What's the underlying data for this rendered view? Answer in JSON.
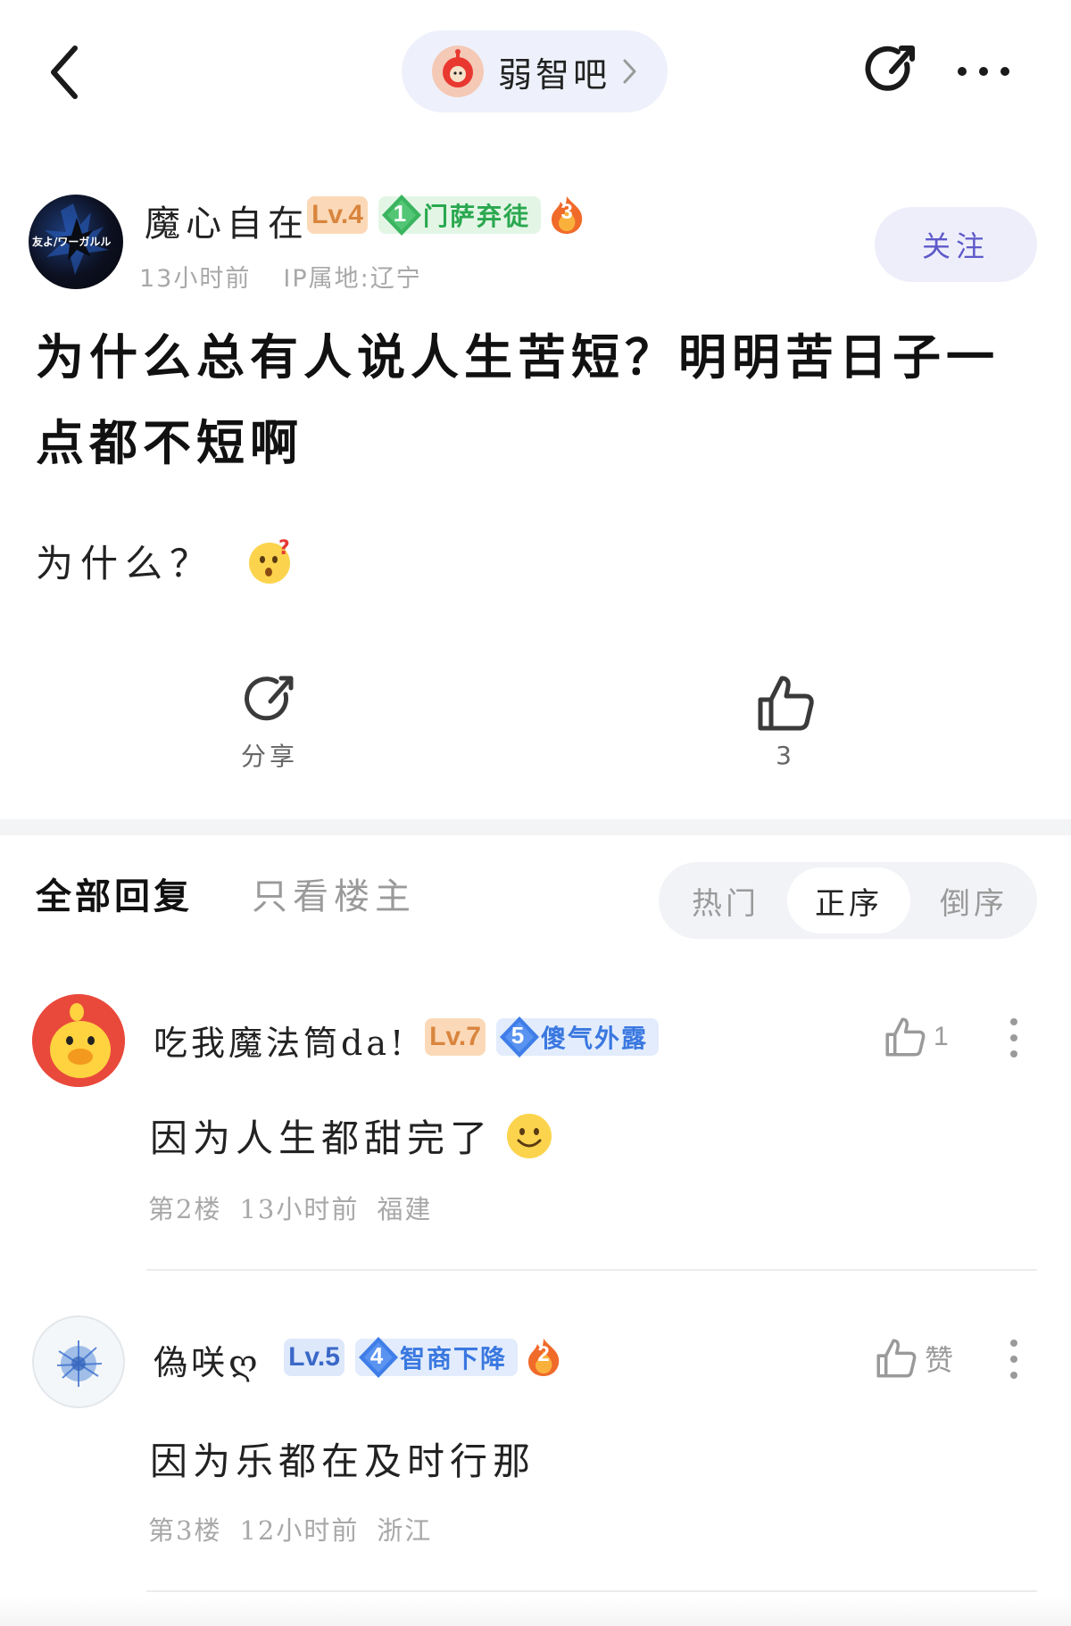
{
  "topbar": {
    "forum_name": "弱智吧",
    "icons": [
      "back-icon",
      "chevron-right-icon",
      "share-icon",
      "more-icon"
    ]
  },
  "author": {
    "name": "魔心自在",
    "level": "Lv.4",
    "tag_number": "1",
    "tag_label": "门萨弃徒",
    "flame_number": "3",
    "time": "13小时前",
    "ip": "IP属地:辽宁",
    "avatar_text": "友よ/ワーガルル",
    "follow_label": "关注"
  },
  "post": {
    "title": "为什么总有人说人生苦短？明明苦日子一点都不短啊",
    "body": "为什么？"
  },
  "actions": {
    "share_label": "分享",
    "like_count": "3"
  },
  "replies_header": {
    "all_tab": "全部回复",
    "op_tab": "只看楼主",
    "sort": [
      "热门",
      "正序",
      "倒序"
    ],
    "active_sort": "正序"
  },
  "comments": [
    {
      "name": "吃我魔法筒da!",
      "level": "Lv.7",
      "tag_number": "5",
      "tag_label": "傻气外露",
      "text": "因为人生都甜完了",
      "floor": "第2楼",
      "time": "13小时前",
      "location": "福建",
      "likes": "1"
    },
    {
      "name": "偽咲ღ",
      "level": "Lv.5",
      "tag_number": "4",
      "tag_label": "智商下降",
      "flame_number": "2",
      "text": "因为乐都在及时行那",
      "floor": "第3楼",
      "time": "12小时前",
      "location": "浙江",
      "like_label": "赞"
    }
  ],
  "colors": {
    "follow_bg": "#eeeefb",
    "follow_text": "#5d59c9",
    "level_orange": "#d9853e",
    "level_blue": "#3a68c8",
    "tag_green": "#2aa84f",
    "tag_blue": "#3a78e0"
  }
}
